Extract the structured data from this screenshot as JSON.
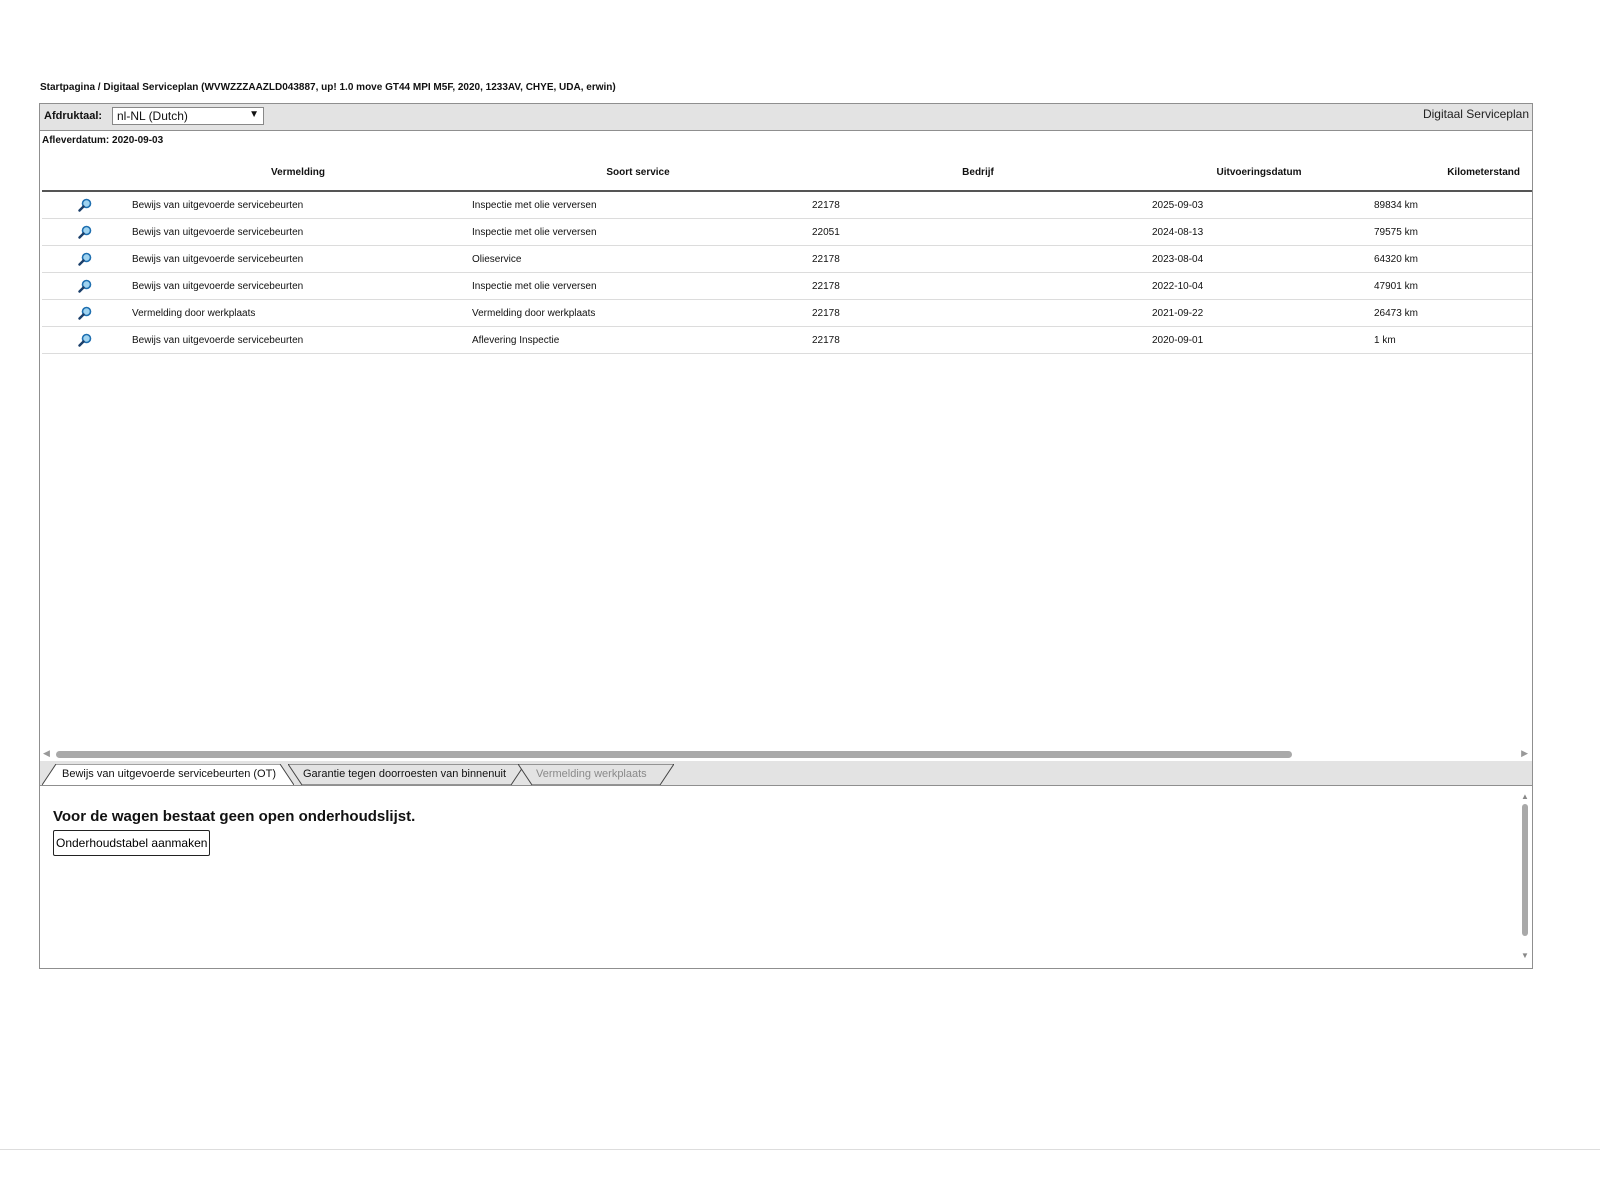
{
  "breadcrumb": "Startpagina / Digitaal Serviceplan (WVWZZZAAZLD043887, up! 1.0 move GT44 MPI M5F, 2020, 1233AV, CHYE, UDA, erwin)",
  "toolbar": {
    "language_label": "Afdruktaal:",
    "language_value": "nl-NL (Dutch)",
    "app_title": "Digitaal Serviceplan"
  },
  "delivery_date": "Afleverdatum: 2020-09-03",
  "table": {
    "headers": [
      "Vermelding",
      "Soort service",
      "Bedrijf",
      "Uitvoeringsdatum",
      "Kilometerstand"
    ],
    "rows": [
      [
        "Bewijs van uitgevoerde servicebeurten",
        "Inspectie met olie verversen",
        "22178",
        "2025-09-03",
        "89834 km"
      ],
      [
        "Bewijs van uitgevoerde servicebeurten",
        "Inspectie met olie verversen",
        "22051",
        "2024-08-13",
        "79575 km"
      ],
      [
        "Bewijs van uitgevoerde servicebeurten",
        "Olieservice",
        "22178",
        "2023-08-04",
        "64320 km"
      ],
      [
        "Bewijs van uitgevoerde servicebeurten",
        "Inspectie met olie verversen",
        "22178",
        "2022-10-04",
        "47901 km"
      ],
      [
        "Vermelding door werkplaats",
        "Vermelding door werkplaats",
        "22178",
        "2021-09-22",
        "26473 km"
      ],
      [
        "Bewijs van uitgevoerde servicebeurten",
        "Aflevering Inspectie",
        "22178",
        "2020-09-01",
        "1 km"
      ]
    ]
  },
  "tabs": [
    {
      "label": "Bewijs van uitgevoerde servicebeurten (OT)",
      "state": "active"
    },
    {
      "label": "Garantie tegen doorroesten van binnenuit",
      "state": "normal"
    },
    {
      "label": "Vermelding werkplaats",
      "state": "disabled"
    }
  ],
  "lower": {
    "message": "Voor de wagen bestaat geen open onderhoudslijst.",
    "create_button": "Onderhoudstabel aanmaken"
  },
  "icons": {
    "row_action": "magnifier-icon"
  },
  "colors": {
    "toolbar_bg": "#e3e3e3",
    "border": "#8f8f8f",
    "icon_blue": "#1f6fb0"
  }
}
